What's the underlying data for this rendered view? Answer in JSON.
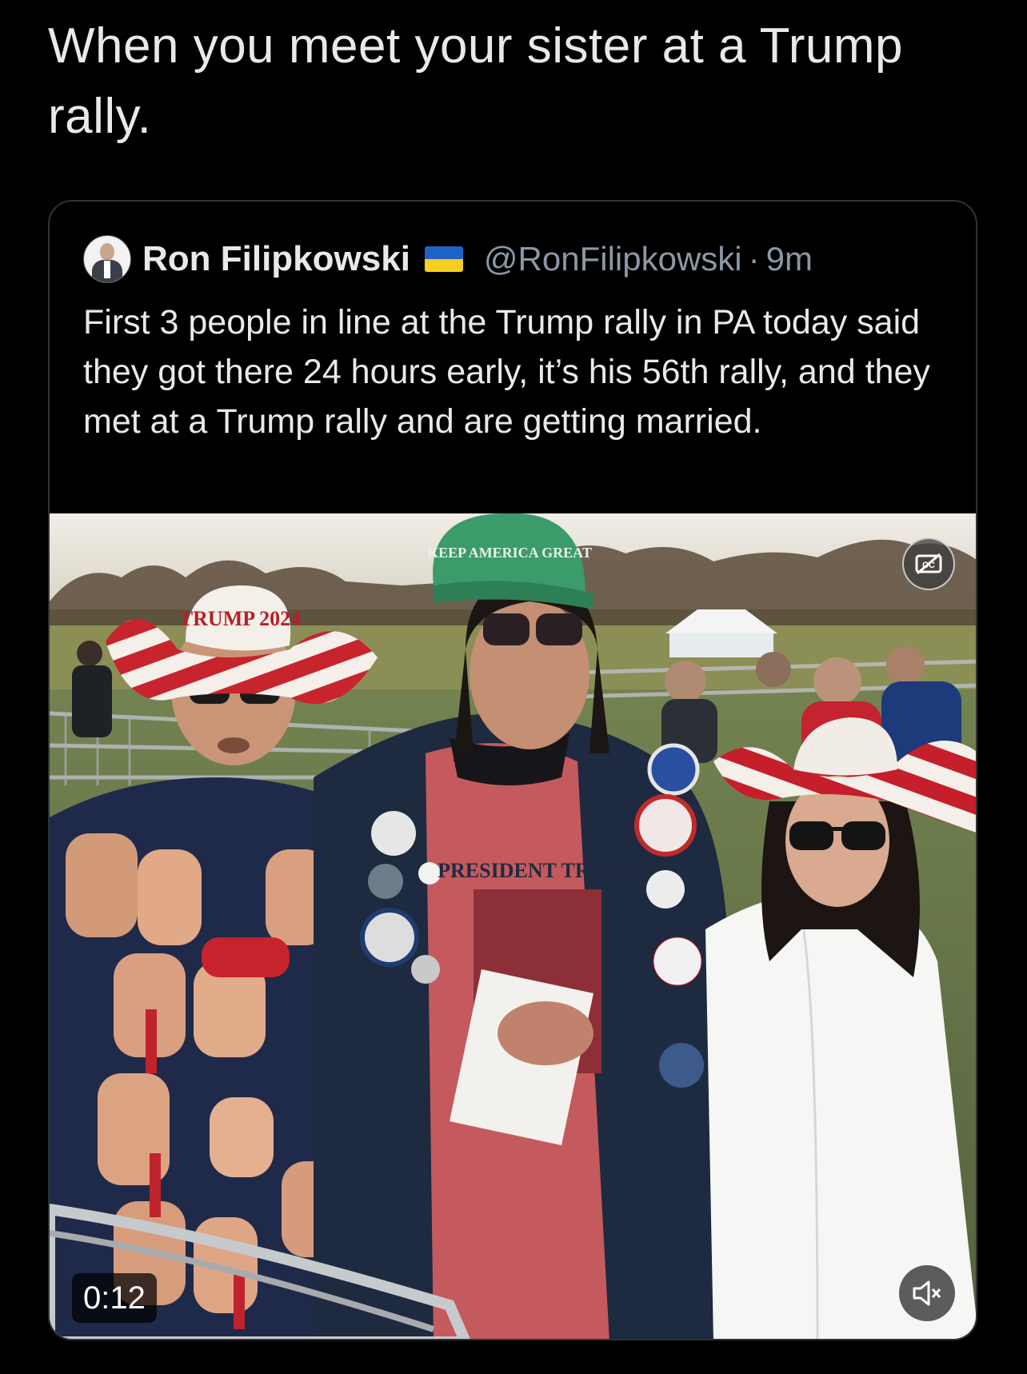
{
  "tweet": {
    "text": "When you meet your sister at a Trump rally."
  },
  "quoted_tweet": {
    "author_name": "Ron Filipkowski",
    "flag_icon": "ukraine-flag-icon",
    "handle": "@RonFilipkowski",
    "separator": "·",
    "time": "9m",
    "text": "First 3 people in line at the Trump rally in PA today said they got there 24 hours early, it’s his 56th rally, and they met at a Trump rally and are getting married.",
    "video": {
      "timestamp": "0:12",
      "cc_icon": "closed-captions-off-icon",
      "mute_icon": "volume-muted-icon",
      "hat_text": "TRUMP 2024",
      "cap_text": "KEEP AMERICA GREAT",
      "shirt_text": "PRESIDENT TRUMP"
    }
  },
  "colors": {
    "background": "#000000",
    "text": "#e7e9ea",
    "secondary": "#8b98a5",
    "border": "#2f3336"
  }
}
